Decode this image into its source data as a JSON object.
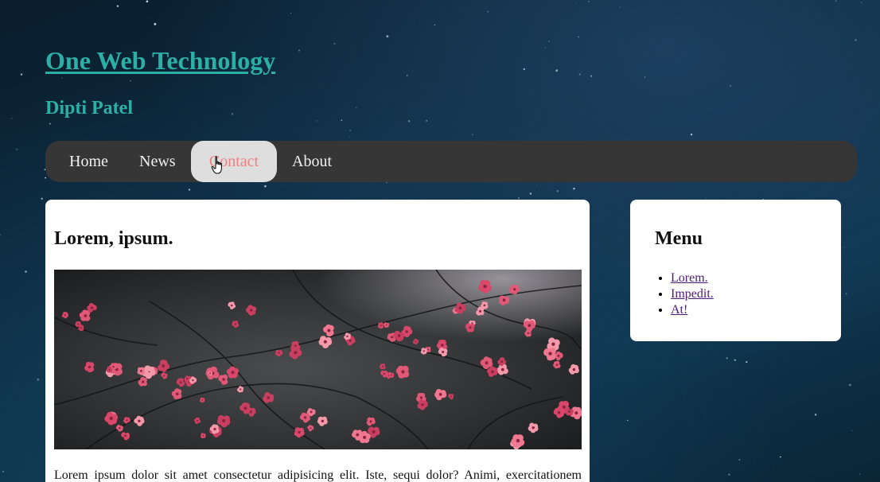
{
  "site": {
    "title": "One Web Technology",
    "subtitle": "Dipti Patel"
  },
  "nav": {
    "items": [
      {
        "label": "Home"
      },
      {
        "label": "News"
      },
      {
        "label": "Contact",
        "state": "hover"
      },
      {
        "label": "About"
      }
    ]
  },
  "main": {
    "heading": "Lorem, ipsum.",
    "image_alt": "pink blossoms on dark branches",
    "paragraph": "Lorem ipsum dolor sit amet consectetur adipisicing elit. Iste, sequi dolor? Animi, exercitationem"
  },
  "sidebar": {
    "heading": "Menu",
    "links": [
      {
        "label": "Lorem."
      },
      {
        "label": "Impedit."
      },
      {
        "label": "At!"
      }
    ]
  },
  "colors": {
    "accent": "#2bb0a6",
    "nav_background": "#363636",
    "nav_hover_background": "#dedede",
    "nav_hover_text": "#f08080",
    "link_visited": "#4b1a7a"
  },
  "icons": {
    "cursor": "hand-pointer-icon"
  }
}
